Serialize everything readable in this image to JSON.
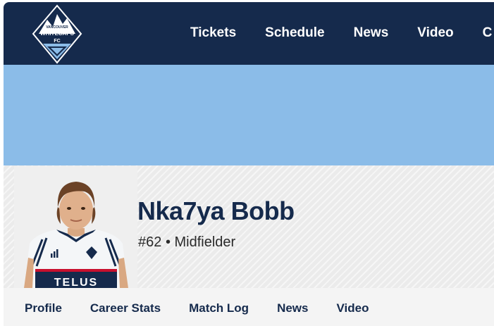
{
  "header": {
    "logo": {
      "icon": "whitecaps-crest-icon",
      "line1": "VANCOUVER",
      "line2": "WHITECAPS",
      "line3": "FC"
    },
    "nav": [
      {
        "label": "Tickets"
      },
      {
        "label": "Schedule"
      },
      {
        "label": "News"
      },
      {
        "label": "Video"
      },
      {
        "label": "C"
      }
    ],
    "background": "#152a4c"
  },
  "banner": {
    "color": "#8bbce8"
  },
  "player": {
    "name": "Nka7ya Bobb",
    "number": "#62",
    "separator": "•",
    "position": "Midfielder",
    "photo": {
      "kit_sponsor": "TELUS",
      "kit_brand_icon": "adidas-logo-icon",
      "crest_icon": "club-crest-icon"
    }
  },
  "subnav": [
    {
      "label": "Profile"
    },
    {
      "label": "Career Stats"
    },
    {
      "label": "Match Log"
    },
    {
      "label": "News"
    },
    {
      "label": "Video"
    }
  ],
  "colors": {
    "navy": "#152a4c",
    "sky": "#8bbce8",
    "panel": "#ebebeb"
  }
}
